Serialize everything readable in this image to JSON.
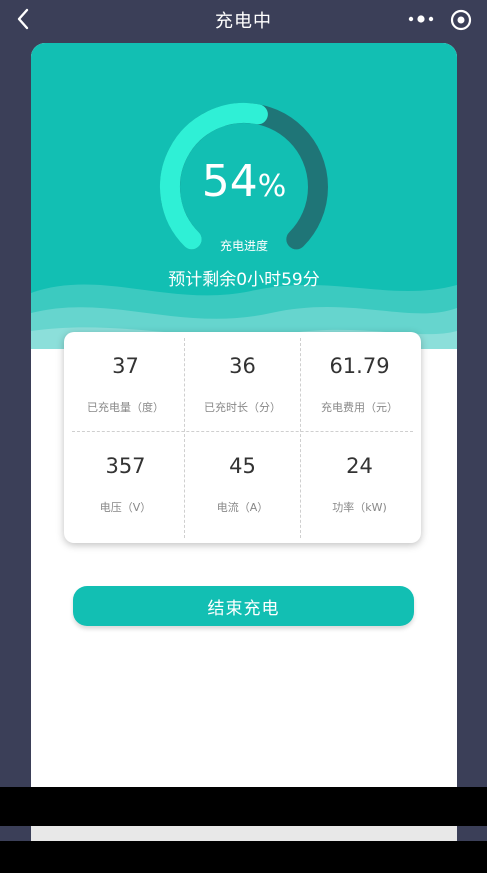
{
  "header": {
    "title": "充电中",
    "back_icon": "chevron-left-icon",
    "more_icon": "more-dots-icon",
    "target_icon": "target-icon"
  },
  "charging": {
    "percent_value": "54",
    "percent_unit": "%",
    "progress": 0.54,
    "progress_label": "充电进度",
    "remaining_text": "预计剩余0小时59分"
  },
  "stats": [
    {
      "value": "37",
      "label": "已充电量（度）"
    },
    {
      "value": "36",
      "label": "已充时长（分）"
    },
    {
      "value": "61.79",
      "label": "充电费用（元）"
    },
    {
      "value": "357",
      "label": "电压（V）"
    },
    {
      "value": "45",
      "label": "电流（A）"
    },
    {
      "value": "24",
      "label": "功率（kW)"
    }
  ],
  "actions": {
    "end_label": "结束充电"
  },
  "colors": {
    "primary": "#12bfb3",
    "gauge_fill": "#2ff0d6",
    "gauge_track": "#1f7577",
    "page_bg": "#3b3f58"
  }
}
